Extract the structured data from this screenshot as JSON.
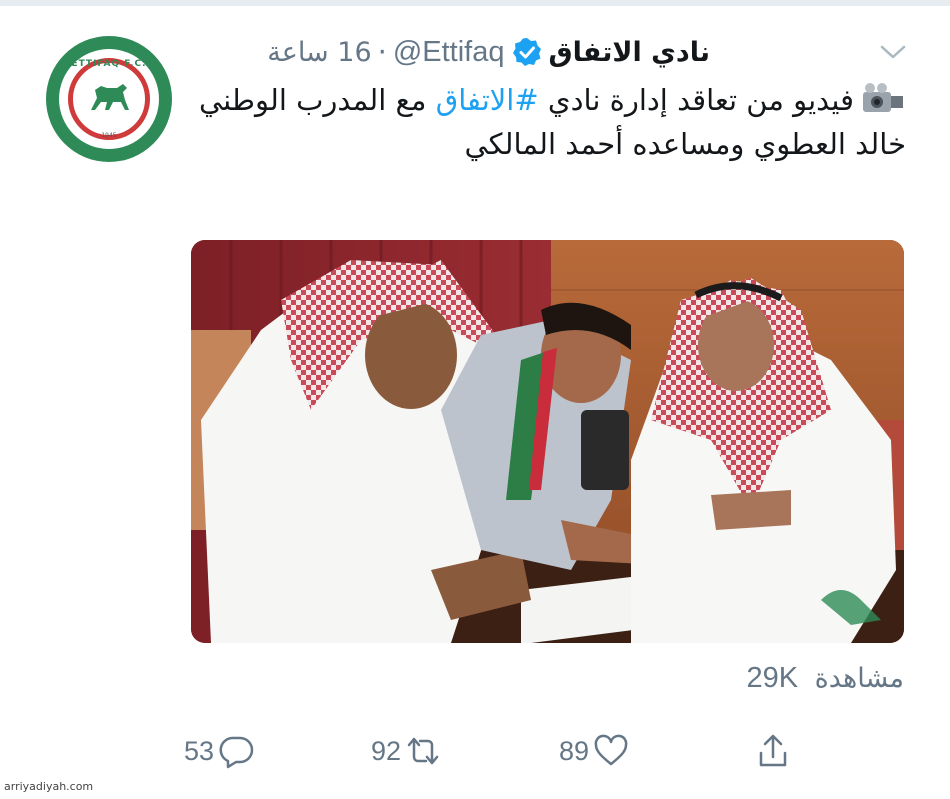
{
  "account": {
    "display_name": "نادي الاتفاق",
    "handle": "@Ettifaq",
    "separator": "·",
    "time": "16 ساعة",
    "verified": true,
    "avatar_text": "ETTIFAQ F.C.",
    "avatar_year": "1945"
  },
  "tweet": {
    "emoji": "video-camera-emoji",
    "text_before": "فيديو من تعاقد إدارة نادي ",
    "hashtag": "#الاتفاق",
    "text_after": " مع المدرب الوطني خالد العطوي ومساعده أحمد المالكي"
  },
  "stats": {
    "views_number": "29K",
    "views_label": "مشاهدة"
  },
  "actions": {
    "replies": "53",
    "retweets": "92",
    "likes": "89"
  },
  "watermark": "arriyadiyah.com",
  "colors": {
    "link": "#1da1f2",
    "muted": "#657786",
    "brand_green": "#2e8b57",
    "brand_red": "#cf3a3a"
  },
  "icons": [
    "verified-badge-icon",
    "chevron-down-icon",
    "reply-icon",
    "retweet-icon",
    "like-icon",
    "share-icon"
  ]
}
